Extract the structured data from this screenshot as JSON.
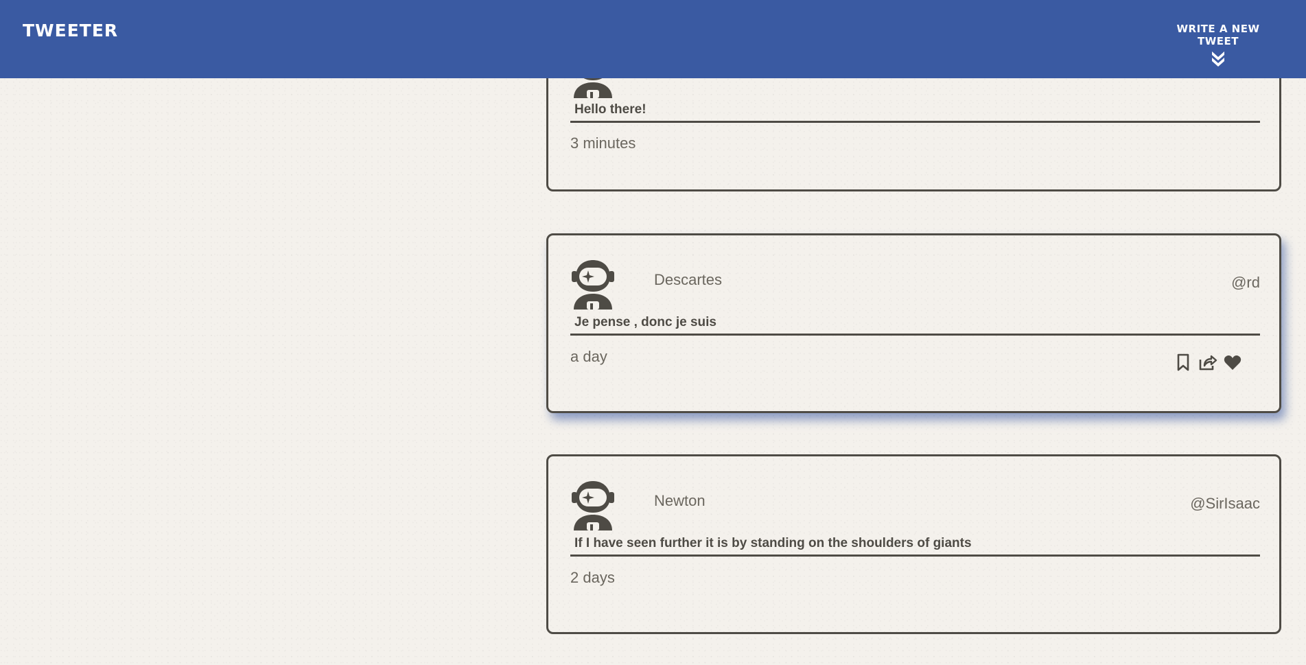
{
  "navbar": {
    "brand": "TWEETER",
    "compose_label": "WRITE A NEW TWEET",
    "compose_icon": "double-chevron-down-icon"
  },
  "colors": {
    "nav_bg": "#3a5aa2",
    "page_bg": "#f4f1ec",
    "ink": "#4e4b45",
    "hover_shadow": "#3a5aa2"
  },
  "tweets": [
    {
      "name": "",
      "handle": "",
      "content": "Hello there!",
      "timestamp": "3 minutes"
    },
    {
      "name": "Descartes",
      "handle": "@rd",
      "content": "Je pense , donc je suis",
      "timestamp": "a day",
      "actions": [
        "bookmark-icon",
        "share-icon",
        "heart-icon"
      ]
    },
    {
      "name": "Newton",
      "handle": "@SirIsaac",
      "content": "If I have seen further it is by standing on the shoulders of giants",
      "timestamp": "2 days"
    }
  ]
}
